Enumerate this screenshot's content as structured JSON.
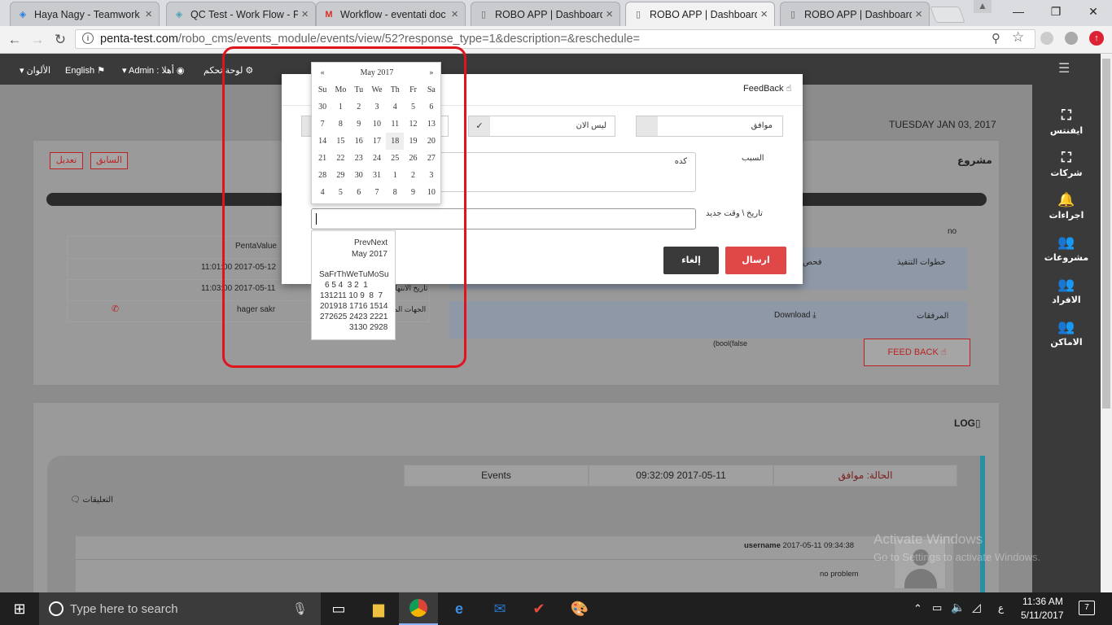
{
  "browser": {
    "tabs": [
      {
        "label": "Haya Nagy - Teamwork",
        "icon": "teamwork-icon",
        "icon_color": "#2b7de1",
        "active": false
      },
      {
        "label": "QC Test - Work Flow - P",
        "icon": "layers-icon",
        "icon_color": "#4aa3b4",
        "active": false
      },
      {
        "label": "Workflow - eventati doc",
        "icon": "gmail-icon",
        "icon_color": "#d93025",
        "active": false
      },
      {
        "label": "ROBO APP | Dashboard",
        "icon": "page-icon",
        "icon_color": "#666666",
        "active": false
      },
      {
        "label": "ROBO APP | Dashboard",
        "icon": "page-icon",
        "icon_color": "#666666",
        "active": true
      },
      {
        "label": "ROBO APP | Dashboard",
        "icon": "page-icon",
        "icon_color": "#666666",
        "active": false
      }
    ],
    "url_host": "penta-test.com",
    "url_path": "/robo_cms/events_module/events/view/52?response_type=1&description=&reschedule="
  },
  "header": {
    "colors": "الألوان",
    "language": "English",
    "admin": "Admin : أهلا",
    "dashboard": "لوحة تحكم"
  },
  "sidebar": [
    {
      "label": "ايفنتس",
      "icon": "expand-icon"
    },
    {
      "label": "شركات",
      "icon": "expand-icon"
    },
    {
      "label": "اجراءات",
      "icon": "bell-icon"
    },
    {
      "label": "مشروعات",
      "icon": "users-icon"
    },
    {
      "label": "الافراد",
      "icon": "users-icon"
    },
    {
      "label": "الاماكن",
      "icon": "users-icon"
    }
  ],
  "page": {
    "date": "TUESDAY JAN 03, 2017",
    "project_title": "مشروع",
    "prev_button": "السابق",
    "edit_button": "تعديل",
    "no_text": "no",
    "table": {
      "header": "PentaValue",
      "row1": "11:01:00 2017-05-12",
      "row2": "11:03:00 2017-05-11",
      "row2_label": "تاريخ الانتهاء",
      "row3": "hager sakr",
      "row3_label": "الجهات الم"
    },
    "steps_label": "خطوات التنفيذ",
    "steps_value": "فحص",
    "attachments_label": "المرفقات",
    "download": "Download",
    "bool_text": "(bool(false",
    "feedback_button": "FEED BACK"
  },
  "log": {
    "title": "LOG",
    "status": "الحالة: موافق",
    "time": "09:32:09 2017-05-11",
    "events": "Events",
    "comments": "التعليقات",
    "comment_user": "username",
    "comment_time": "2017-05-11 09:34:38",
    "comment_text": "no problem"
  },
  "modal": {
    "title": "FeedBack",
    "opt_agree": "موافق",
    "opt_not_now": "ليس الان",
    "check": "✓",
    "reason_label": "السبب",
    "reason_value": "كده",
    "datetime_label": "تاريخ \\ وقت جديد",
    "send_button": "ارسال",
    "cancel_button": "إلغاء"
  },
  "calendar": {
    "prev": "«",
    "next": "»",
    "month": "May 2017",
    "days": [
      "Su",
      "Mo",
      "Tu",
      "We",
      "Th",
      "Fr",
      "Sa"
    ],
    "weeks": [
      [
        "30",
        "1",
        "2",
        "3",
        "4",
        "5",
        "6"
      ],
      [
        "7",
        "8",
        "9",
        "10",
        "11",
        "12",
        "13"
      ],
      [
        "14",
        "15",
        "16",
        "17",
        "18",
        "19",
        "20"
      ],
      [
        "21",
        "22",
        "23",
        "24",
        "25",
        "26",
        "27"
      ],
      [
        "28",
        "29",
        "30",
        "31",
        "1",
        "2",
        "3"
      ],
      [
        "4",
        "5",
        "6",
        "7",
        "8",
        "9",
        "10"
      ]
    ],
    "selected": "18"
  },
  "calendar2": {
    "nav": "PrevNext",
    "month": "May 2017",
    "days": "SaFrThWeTuMoSu",
    "lines": [
      "6 5 4  3 2  1",
      "131211 10 9  8  7",
      "201918 1716 1514",
      "272625 2423 2221",
      "3130 2928"
    ]
  },
  "watermark": {
    "line1": "Activate Windows",
    "line2": "Go to Settings to activate Windows."
  },
  "taskbar": {
    "search": "Type here to search",
    "time": "11:36 AM",
    "date": "5/11/2017",
    "lang": "ع",
    "notif": "7"
  }
}
